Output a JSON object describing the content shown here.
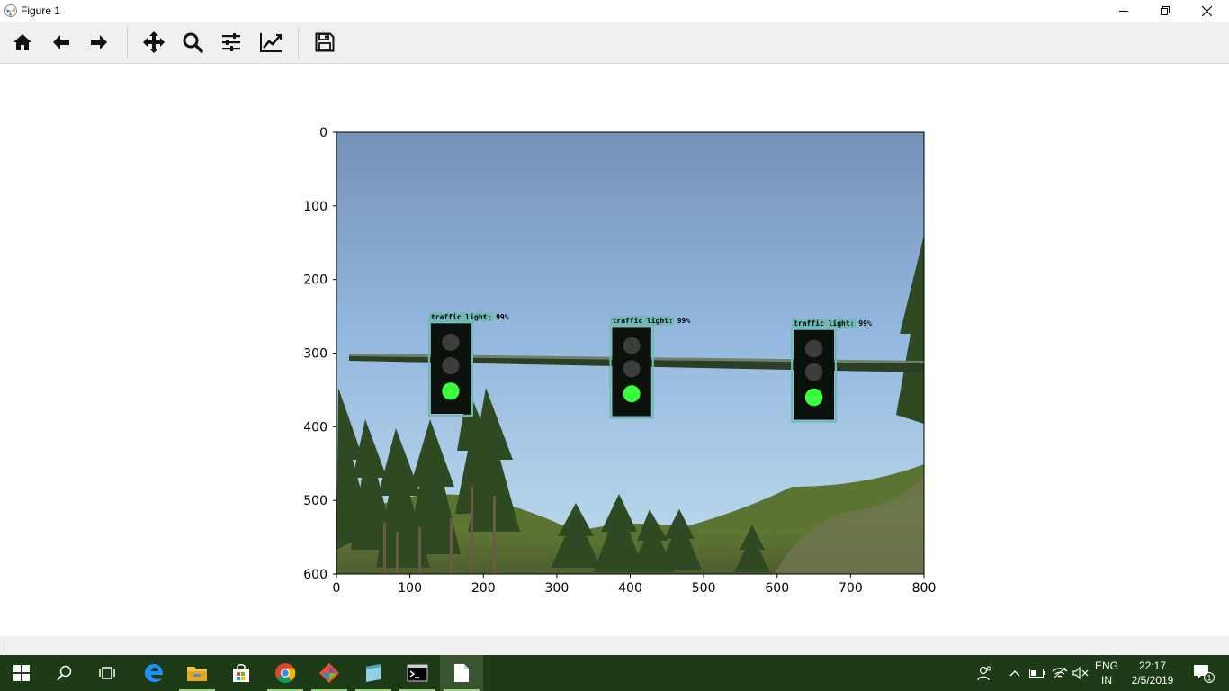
{
  "window": {
    "title": "Figure 1",
    "controls": [
      "minimize-icon",
      "restore-icon",
      "close-icon"
    ]
  },
  "toolbar": {
    "buttons": [
      {
        "name": "home",
        "icon": "home-icon"
      },
      {
        "name": "back",
        "icon": "arrow-left-icon"
      },
      {
        "name": "forward",
        "icon": "arrow-right-icon"
      },
      {
        "name": "pan",
        "icon": "move-icon"
      },
      {
        "name": "zoom",
        "icon": "magnifier-icon"
      },
      {
        "name": "subplots",
        "icon": "sliders-icon"
      },
      {
        "name": "edit-axis",
        "icon": "chart-line-icon"
      },
      {
        "name": "save",
        "icon": "floppy-disk-icon"
      }
    ]
  },
  "chart_data": {
    "type": "image",
    "xlim": [
      0,
      800
    ],
    "ylim": [
      600,
      0
    ],
    "x_ticks": [
      "0",
      "100",
      "200",
      "300",
      "400",
      "500",
      "600",
      "700",
      "800"
    ],
    "y_ticks": [
      "0",
      "100",
      "200",
      "300",
      "400",
      "500",
      "600"
    ],
    "detections": [
      {
        "label": "traffic light: 99%",
        "x0": 126,
        "y0": 257,
        "x1": 185,
        "y1": 385
      },
      {
        "label": "traffic light: 99%",
        "x0": 373,
        "y0": 262,
        "x1": 431,
        "y1": 388
      },
      {
        "label": "traffic light: 99%",
        "x0": 620,
        "y0": 266,
        "x1": 680,
        "y1": 393
      }
    ],
    "colors": {
      "box": "#6fb9b4",
      "lit_lamp": "#39ff3f",
      "sky_top": "#7893b8",
      "sky_bottom": "#b9d8ec"
    }
  },
  "taskbar": {
    "apps": [
      "windows-start-icon",
      "search-icon",
      "task-view-icon",
      "edge-icon",
      "file-explorer-icon",
      "store-icon",
      "chrome-icon",
      "git-icon",
      "notepad-icon",
      "terminal-icon",
      "document-icon"
    ],
    "tray": {
      "language": "ENG",
      "region": "IN",
      "time": "22:17",
      "date": "2/5/2019",
      "notifications": "1"
    }
  }
}
